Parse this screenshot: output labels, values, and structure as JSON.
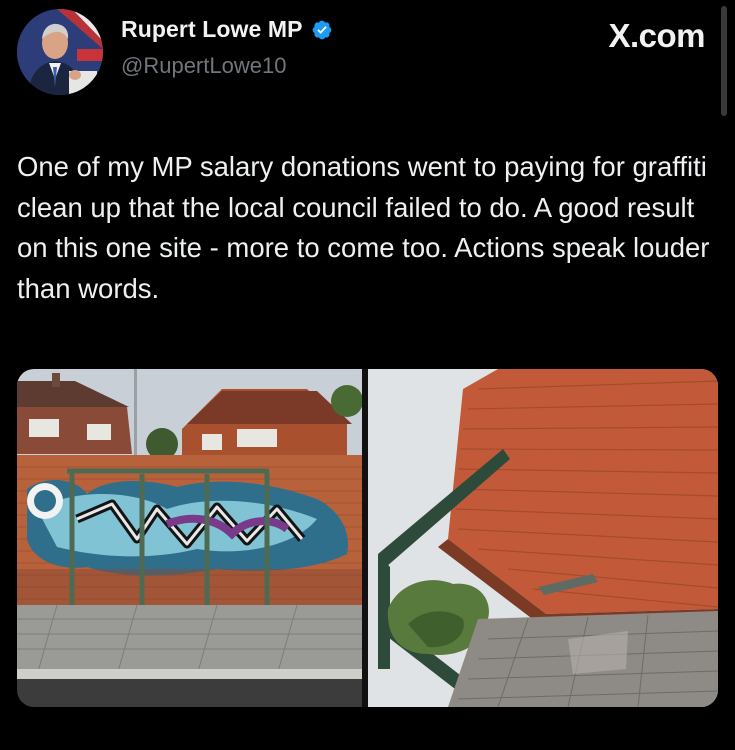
{
  "author": {
    "name": "Rupert Lowe MP",
    "handle": "@RupertLowe10",
    "verified_icon": "verified-badge-icon",
    "verified_color": "#1d9bf0"
  },
  "watermark": "X.com",
  "tweet": {
    "text": "One of my MP salary donations went to paying for graffiti clean up that the local council failed to do. A good result on this one site - more to come too. Actions speak louder than words."
  },
  "media": [
    {
      "label": "before-photo-graffiti-wall"
    },
    {
      "label": "after-photo-clean-brick-wall"
    }
  ],
  "colors": {
    "background": "#000000",
    "text": "#e7e9ea",
    "secondary": "#71767b"
  }
}
